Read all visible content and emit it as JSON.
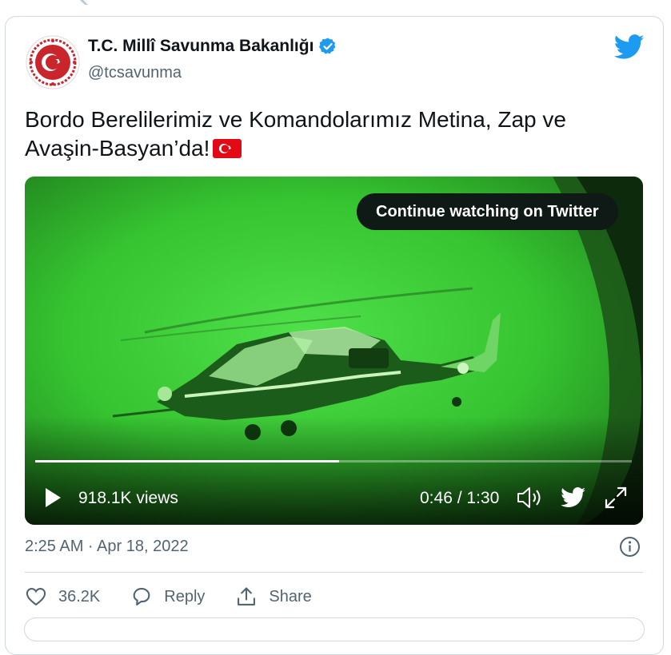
{
  "tweet": {
    "author_name": "T.C. Millî Savunma Bakanlığı",
    "author_handle": "@tcsavunma",
    "text": "Bordo Berelilerimiz ve Komandolarımız Metina, Zap ve Avaşin-Basyan’da!",
    "flag_icon": "turkey-flag-icon"
  },
  "video": {
    "cta_label": "Continue watching on Twitter",
    "views": "918.1K views",
    "time": "0:46 / 1:30",
    "progress": 0.51
  },
  "meta": {
    "timestamp": "2:25 AM · Apr 18, 2022"
  },
  "actions": {
    "like_count": "36.2K",
    "reply_label": "Reply",
    "share_label": "Share"
  },
  "colors": {
    "twitter_blue": "#1d9bf0",
    "night_vision_green": "#3fcf3a",
    "seal_red": "#c8252c",
    "secondary_text": "#536471"
  }
}
